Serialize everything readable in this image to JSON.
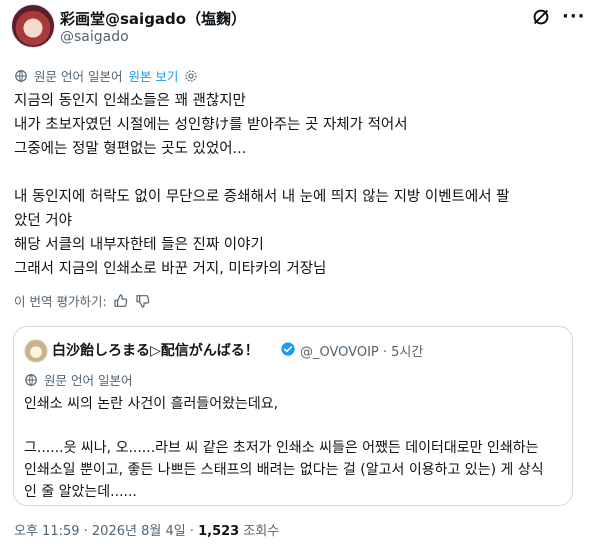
{
  "author": {
    "name": "彩画堂@saigado（塩麴）",
    "handle": "@saigado"
  },
  "translation": {
    "label": "원문 언어 일본어",
    "show_original": "원본 보기"
  },
  "tweet_lines": [
    "지금의 동인지 인쇄소들은 꽤 괜찮지만",
    "내가 초보자였던 시절에는 성인향け를 받아주는 곳 자체가 적어서",
    "그중에는 정말 형편없는 곳도 있었어...",
    "",
    "내 동인지에 허락도 없이 무단으로 증쇄해서 내 눈에 띄지 않는 지방 이벤트에서 팔",
    "았던 거야",
    "해당 서클의 내부자한테 들은 진짜 이야기",
    "그래서 지금의 인쇄소로 바꾼 거지, 미타카의 거장님"
  ],
  "rate": {
    "label": "이 번역 평가하기:"
  },
  "quote": {
    "name": "白沙飴しろまる▷配信がんばる！",
    "handle": "@_OVOVOIP · 5시간",
    "translation_label": "원문 언어 일본어",
    "lines": [
      "인쇄소 씨의 논란 사건이 흘러들어왔는데요,",
      "",
      "그......읏 씨나, 오......라브 씨 같은 초저가 인쇄소 씨들은 어쨌든 데이터대로만 인쇄하는",
      "인쇄소일 뿐이고, 좋든 나쁘든 스태프의 배려는 없다는 걸 (알고서 이용하고 있는) 게 상식",
      "인 줄 알았는데......"
    ]
  },
  "footer": {
    "time": "오후 11:59 · 2026년 8월 4일 · ",
    "views_count": "1,523",
    "views_label": " 조회수"
  },
  "colors": {
    "accent": "#1d9bf0",
    "muted": "#536471",
    "border": "#cfd9de",
    "text": "#0f1419"
  }
}
